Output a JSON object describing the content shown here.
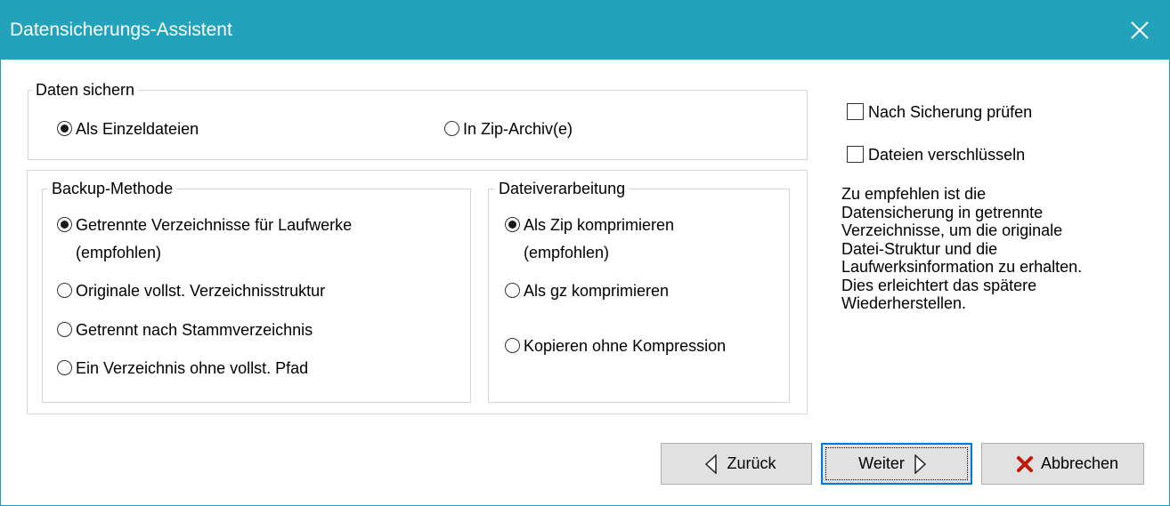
{
  "window": {
    "title": "Datensicherungs-Assistent",
    "accent_color": "#22a3bb",
    "close_icon": "close-icon"
  },
  "backup_target": {
    "legend": "Daten sichern",
    "options": [
      {
        "label": "Als Einzeldateien",
        "selected": true
      },
      {
        "label": "In Zip-Archiv(e)",
        "selected": false
      }
    ]
  },
  "backup_method": {
    "legend": "Backup-Methode",
    "options": [
      {
        "label_line1": "Getrennte Verzeichnisse für Laufwerke",
        "label_line2": "(empfohlen)",
        "selected": true
      },
      {
        "label": "Originale vollst. Verzeichnisstruktur",
        "selected": false
      },
      {
        "label": "Getrennt nach Stammverzeichnis",
        "selected": false
      },
      {
        "label": "Ein Verzeichnis ohne vollst. Pfad",
        "selected": false
      }
    ]
  },
  "file_processing": {
    "legend": "Dateiverarbeitung",
    "options": [
      {
        "label_line1": "Als Zip komprimieren",
        "label_line2": "(empfohlen)",
        "selected": true
      },
      {
        "label": "Als gz komprimieren",
        "selected": false
      },
      {
        "label": "Kopieren ohne Kompression",
        "selected": false
      }
    ]
  },
  "checks": {
    "verify": {
      "label": "Nach Sicherung prüfen",
      "checked": false
    },
    "encrypt": {
      "label": "Dateien verschlüsseln",
      "checked": false
    }
  },
  "hint": {
    "lines": [
      "Zu empfehlen ist die",
      "Datensicherung in getrennte",
      "Verzeichnisse, um die originale",
      "Datei-Struktur und die",
      "Laufwerksinformation zu erhalten.",
      "Dies erleichtert das spätere",
      "Wiederherstellen."
    ]
  },
  "buttons": {
    "back": {
      "label": "Zurück",
      "icon": "triangle-left-icon"
    },
    "next": {
      "label": "Weiter",
      "icon": "triangle-right-icon"
    },
    "cancel": {
      "label": "Abbrechen",
      "icon": "red-x-icon",
      "icon_color": "#c21807"
    }
  }
}
